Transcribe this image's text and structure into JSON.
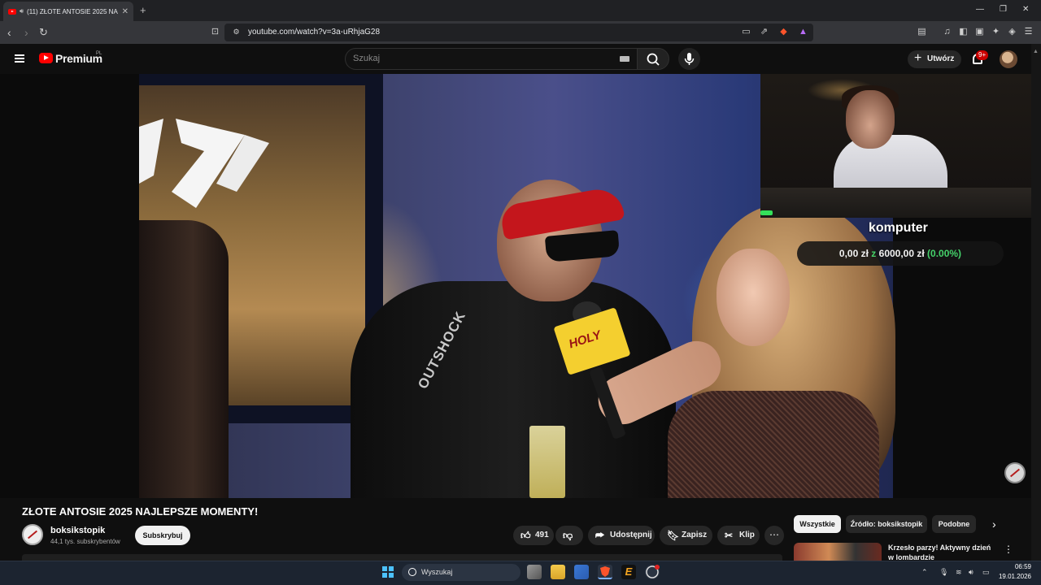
{
  "browser": {
    "tab_title": "(11) ZŁOTE ANTOSIE 2025 NA",
    "new_tab": "+",
    "close_tab": "✕",
    "url": "youtube.com/watch?v=3a-uRhjaG28",
    "window_controls": {
      "minimize": "—",
      "maximize": "❐",
      "close": "✕"
    }
  },
  "youtube_header": {
    "logo_text": "Premium",
    "region": "PL",
    "search_placeholder": "Szukaj",
    "create_label": "Utwórz",
    "notifications_badge": "9+"
  },
  "video": {
    "jacket_text": "OUTSHOCK",
    "mic_flag_text": "HOLY",
    "overlay": {
      "title": "komputer",
      "amount": "0,00 zł",
      "separator": "z",
      "goal": "6000,00 zł",
      "percent": "(0.00%)",
      "progress": 0.0
    }
  },
  "watch": {
    "title": "ZŁOTE ANTOSIE 2025 NAJLEPSZE MOMENTY!",
    "channel_name": "boksikstopik",
    "subscribers": "44,1 tys. subskrybentów",
    "subscribe_label": "Subskrybuj",
    "likes": "491",
    "share_label": "Udostępnij",
    "save_label": "Zapisz",
    "clip_label": "Klip",
    "more_label": "⋯"
  },
  "related": {
    "chips": [
      "Wszystkie",
      "Źródło: boksikstopik",
      "Podobne"
    ],
    "first_video_title": "Krzesło parzy! Aktywny dzień w lombardzie"
  },
  "taskbar": {
    "search_label": "Wyszukaj",
    "time": "06:59",
    "date": "19.01.2026"
  },
  "colors": {
    "youtube_red": "#ff0000",
    "background": "#0f0f0f",
    "overlay_green": "#45d26a",
    "bandana_red": "#c4161c",
    "mic_flag_yellow": "#f4cf2f"
  }
}
